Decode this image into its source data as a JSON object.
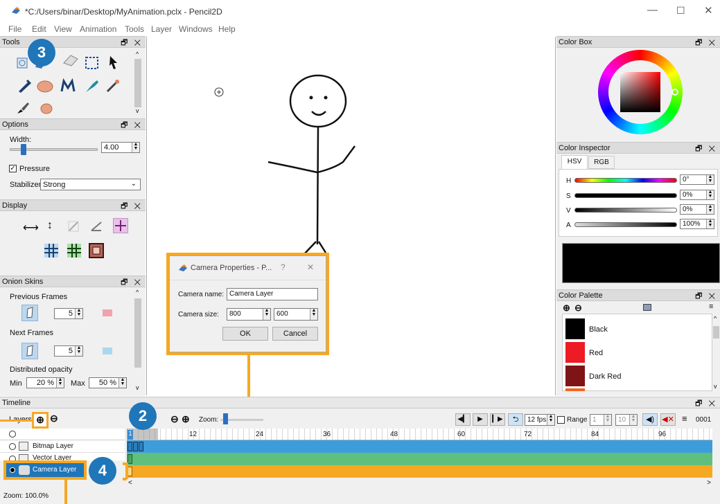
{
  "window": {
    "title": "*C:/Users/binar/Desktop/MyAnimation.pclx - Pencil2D",
    "min": "—",
    "max": "☐",
    "close": "✕"
  },
  "menu": [
    "File",
    "Edit",
    "View",
    "Animation",
    "Tools",
    "Layer",
    "Windows",
    "Help"
  ],
  "tools_panel": {
    "title": "Tools",
    "ctl": "🗗 ✕"
  },
  "options_panel": {
    "title": "Options",
    "width_label": "Width:",
    "width_value": "4.00",
    "pressure_label": "Pressure",
    "stabilizer_label": "Stabilizer",
    "stabilizer_value": "Strong"
  },
  "display_panel": {
    "title": "Display"
  },
  "onion_panel": {
    "title": "Onion Skins",
    "prev_label": "Previous Frames",
    "prev_value": "5",
    "next_label": "Next Frames",
    "next_value": "5",
    "dist_label": "Distributed opacity",
    "min_label": "Min",
    "min_value": "20 %",
    "max_label": "Max",
    "max_value": "50 %"
  },
  "colorbox": {
    "title": "Color Box"
  },
  "inspector": {
    "title": "Color Inspector",
    "tab_hsv": "HSV",
    "tab_rgb": "RGB",
    "h_label": "H",
    "h_value": "0°",
    "s_label": "S",
    "s_value": "0%",
    "v_label": "V",
    "v_value": "0%",
    "a_label": "A",
    "a_value": "100%"
  },
  "palette": {
    "title": "Color Palette",
    "items": [
      {
        "name": "Black",
        "color": "#000000"
      },
      {
        "name": "Red",
        "color": "#ed1c24"
      },
      {
        "name": "Dark Red",
        "color": "#7f1416"
      }
    ]
  },
  "dialog": {
    "title": "Camera Properties - P...",
    "help": "?",
    "close": "✕",
    "name_label": "Camera name:",
    "name_value": "Camera Layer",
    "size_label": "Camera size:",
    "width_value": "800",
    "height_value": "600",
    "ok": "OK",
    "cancel": "Cancel"
  },
  "timeline": {
    "title": "Timeline",
    "layers_label": "Layers",
    "zoom_label": "Zoom:",
    "fps": "12 fps",
    "range_label": "Range",
    "range_start": "1",
    "range_end": "10",
    "frame_counter": "0001",
    "ticks": [
      "12",
      "24",
      "36",
      "48",
      "60",
      "72",
      "84",
      "96"
    ],
    "layers": [
      {
        "name": "Bitmap Layer",
        "color": "#3d9ddc"
      },
      {
        "name": "Vector Layer",
        "color": "#5fbf7d"
      },
      {
        "name": "Camera Layer",
        "color": "#f7a823"
      }
    ],
    "status": "Zoom: 100.0%"
  },
  "badges": [
    "3",
    "2",
    "4"
  ],
  "accent": "#f7a823",
  "badge_color": "#1f76b8"
}
